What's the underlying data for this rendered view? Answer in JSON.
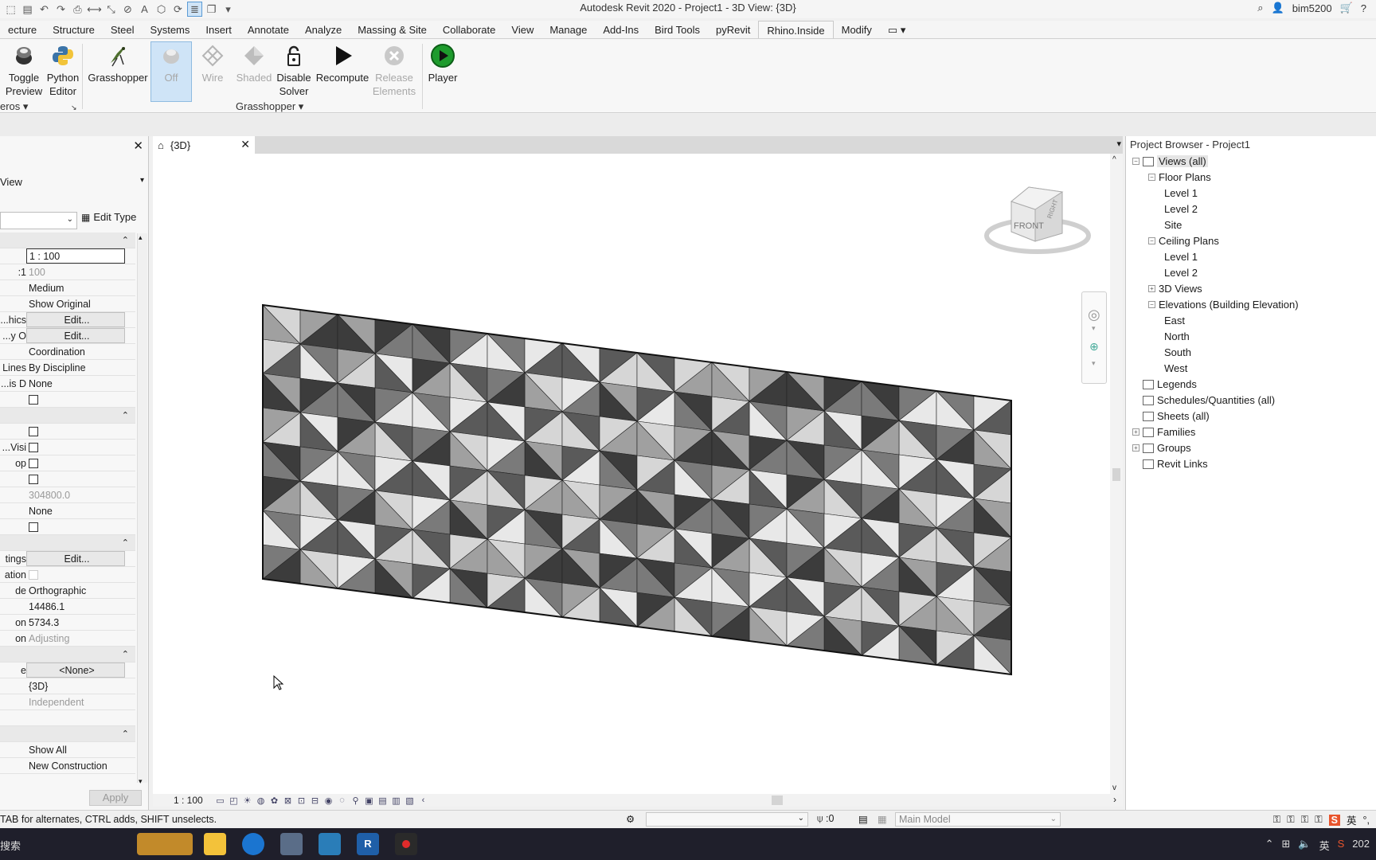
{
  "titlebar": {
    "title": "Autodesk Revit 2020 - Project1 - 3D View: {3D}",
    "user": "bim5200"
  },
  "ribbon_tabs": [
    "ecture",
    "Structure",
    "Steel",
    "Systems",
    "Insert",
    "Annotate",
    "Analyze",
    "Massing & Site",
    "Collaborate",
    "View",
    "Manage",
    "Add-Ins",
    "Bird Tools",
    "pyRevit",
    "Rhino.Inside",
    "Modify"
  ],
  "ribbon_active_tab": "Rhino.Inside",
  "ribbon": {
    "toggle_preview": "Toggle Preview",
    "python_editor": "Python Editor",
    "grasshopper": "Grasshopper",
    "off": "Off",
    "wire": "Wire",
    "shaded": "Shaded",
    "disable_solver": "Disable Solver",
    "recompute": "Recompute",
    "release_elements": "Release Elements",
    "player": "Player",
    "panel_left": "eros",
    "panel_grasshopper": "Grasshopper"
  },
  "properties": {
    "type_label": "View",
    "edit_type": "Edit Type",
    "apply": "Apply",
    "rows": [
      {
        "kind": "sec"
      },
      {
        "label": "",
        "value": "1 : 100",
        "style": "boxed"
      },
      {
        "label": "1:",
        "value": "100",
        "style": "dim"
      },
      {
        "label": "",
        "value": "Medium"
      },
      {
        "label": "",
        "value": "Show Original"
      },
      {
        "label": "hics...",
        "value": "Edit...",
        "style": "btn"
      },
      {
        "label": "y O...",
        "value": "Edit...",
        "style": "btn"
      },
      {
        "label": "",
        "value": "Coordination"
      },
      {
        "label": "Lines",
        "value": "By Discipline"
      },
      {
        "label": "is D...",
        "value": "None"
      },
      {
        "label": "",
        "value": "",
        "style": "cb"
      },
      {
        "kind": "sec"
      },
      {
        "label": "",
        "value": "",
        "style": "cb"
      },
      {
        "label": "Visi...",
        "value": "",
        "style": "cb"
      },
      {
        "label": "op",
        "value": "",
        "style": "cb"
      },
      {
        "label": "",
        "value": "",
        "style": "cb"
      },
      {
        "label": "",
        "value": "304800.0",
        "style": "dim"
      },
      {
        "label": "",
        "value": "None"
      },
      {
        "label": "",
        "value": "",
        "style": "cb"
      },
      {
        "kind": "sec"
      },
      {
        "label": "tings",
        "value": "Edit...",
        "style": "btn"
      },
      {
        "label": "ation",
        "value": "",
        "style": "cbdim"
      },
      {
        "label": "de",
        "value": "Orthographic"
      },
      {
        "label": "",
        "value": "14486.1"
      },
      {
        "label": "on",
        "value": "5734.3"
      },
      {
        "label": "on",
        "value": "Adjusting",
        "style": "dim"
      },
      {
        "kind": "sec"
      },
      {
        "label": "e",
        "value": "<None>",
        "style": "btn"
      },
      {
        "label": "",
        "value": "{3D}"
      },
      {
        "label": "",
        "value": "Independent",
        "style": "dim"
      },
      {
        "label": "",
        "value": ""
      },
      {
        "kind": "sec"
      },
      {
        "label": "",
        "value": "Show All"
      },
      {
        "label": "",
        "value": "New Construction"
      }
    ]
  },
  "view_tab": {
    "label": "{3D}"
  },
  "view_control": {
    "scale": "1 : 100"
  },
  "viewcube": {
    "front": "FRONT",
    "right": "RIGHT"
  },
  "project_browser": {
    "title": "Project Browser - Project1",
    "nodes": [
      {
        "label": "Views (all)",
        "level": 0,
        "toggle": "−",
        "selected": true
      },
      {
        "label": "Floor Plans",
        "level": 1,
        "toggle": "−"
      },
      {
        "label": "Level 1",
        "level": 2
      },
      {
        "label": "Level 2",
        "level": 2
      },
      {
        "label": "Site",
        "level": 2
      },
      {
        "label": "Ceiling Plans",
        "level": 1,
        "toggle": "−"
      },
      {
        "label": "Level 1",
        "level": 2
      },
      {
        "label": "Level 2",
        "level": 2
      },
      {
        "label": "3D Views",
        "level": 1,
        "toggle": "+"
      },
      {
        "label": "Elevations (Building Elevation)",
        "level": 1,
        "toggle": "−"
      },
      {
        "label": "East",
        "level": 2
      },
      {
        "label": "North",
        "level": 2
      },
      {
        "label": "South",
        "level": 2
      },
      {
        "label": "West",
        "level": 2
      },
      {
        "label": "Legends",
        "level": 0
      },
      {
        "label": "Schedules/Quantities (all)",
        "level": 0
      },
      {
        "label": "Sheets (all)",
        "level": 0
      },
      {
        "label": "Families",
        "level": 0,
        "toggle": "+"
      },
      {
        "label": "Groups",
        "level": 0,
        "toggle": "+"
      },
      {
        "label": "Revit Links",
        "level": 0
      }
    ]
  },
  "statusbar": {
    "message": "TAB for alternates, CTRL adds, SHIFT unselects.",
    "selection_count": ":0",
    "model": "Main Model"
  },
  "taskbar": {
    "search": "搜索",
    "ime": "英",
    "clock": "202"
  },
  "colors": {
    "facet_light": "#d6d6d6",
    "facet_mid": "#a0a0a0",
    "facet_dark": "#3c3c3c",
    "selection_blue": "#cfe4f7"
  }
}
